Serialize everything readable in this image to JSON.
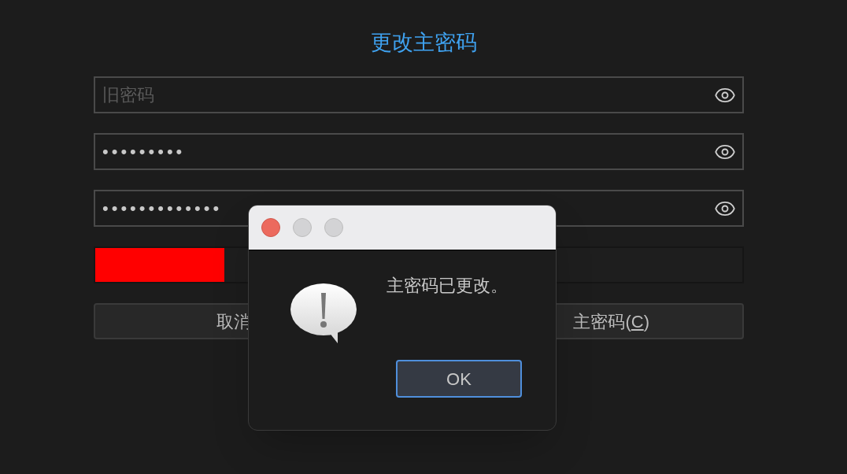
{
  "title": "更改主密码",
  "fields": [
    {
      "placeholder": "旧密码"
    },
    {
      "value": "•••••••••"
    },
    {
      "value": "•••••••••••••"
    }
  ],
  "strength": {
    "level": 0.2,
    "color": "#ff0000"
  },
  "buttons": [
    {
      "label": "取消",
      "kind": "cancel"
    },
    {
      "label": "主密码(",
      "mnemonic": "C",
      "suffix": ")",
      "kind": "confirm"
    }
  ],
  "dialog": {
    "message": "主密码已更改。",
    "ok_button": {
      "label": "OK",
      "focused": true
    }
  }
}
